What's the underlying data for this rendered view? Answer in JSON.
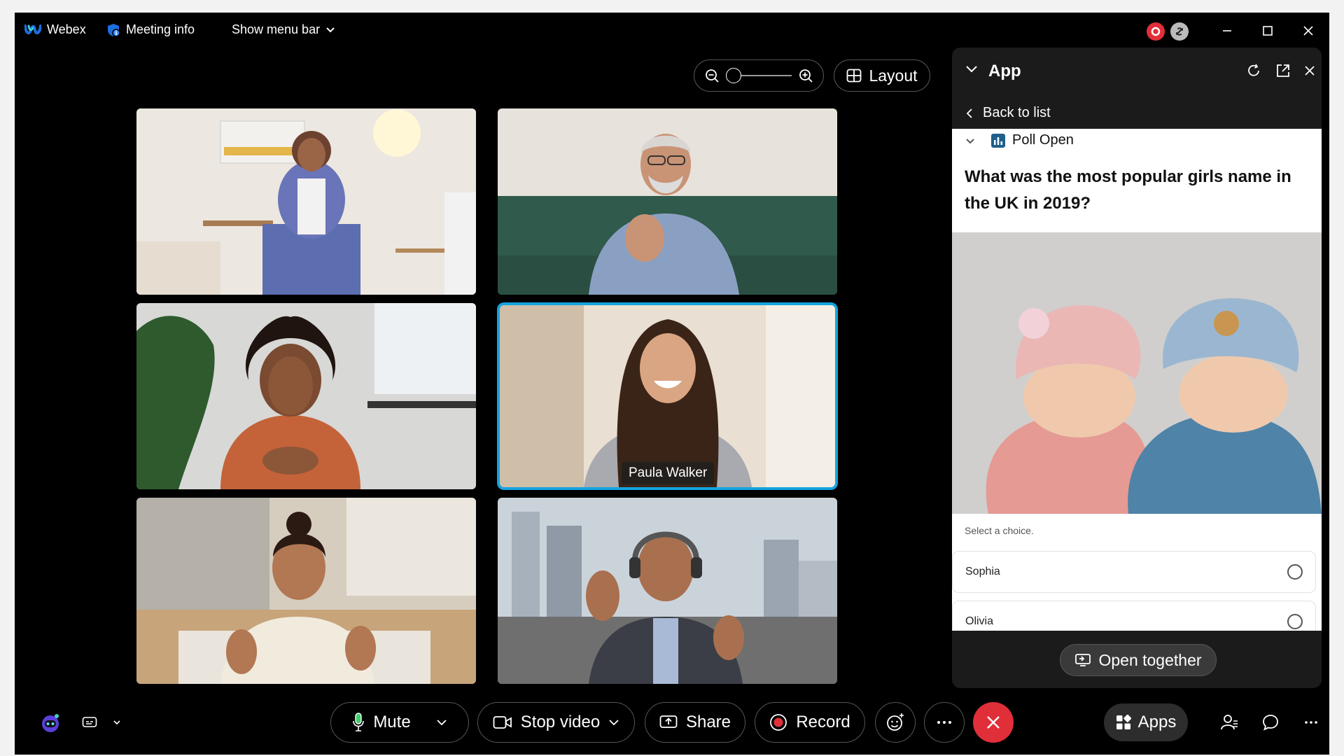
{
  "titlebar": {
    "app_name": "Webex",
    "meeting_info": "Meeting info",
    "show_menu_bar": "Show menu bar"
  },
  "toolbar": {
    "layout_label": "Layout"
  },
  "participants": [
    {
      "name": ""
    },
    {
      "name": ""
    },
    {
      "name": ""
    },
    {
      "name": "Paula Walker",
      "active_speaker": true
    },
    {
      "name": ""
    },
    {
      "name": ""
    }
  ],
  "panel": {
    "title": "App",
    "back_label": "Back to list",
    "poll_status": "Poll Open",
    "question": "What was the most popular girls name in the UK in 2019?",
    "prompt": "Select a choice.",
    "choices": [
      "Sophia",
      "Olivia"
    ],
    "open_together_label": "Open together"
  },
  "controls": {
    "mute_label": "Mute",
    "stop_video_label": "Stop video",
    "share_label": "Share",
    "record_label": "Record",
    "apps_label": "Apps"
  },
  "colors": {
    "active_speaker_border": "#13a4e0",
    "end_call": "#e12f3a",
    "record_dot": "#e12f3a",
    "webex_blue": "#1d6fe0"
  }
}
